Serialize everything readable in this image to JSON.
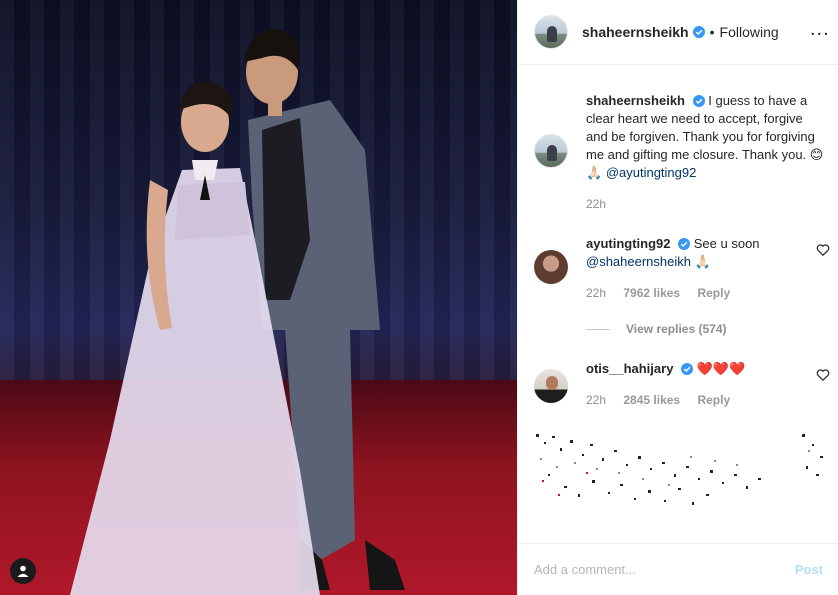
{
  "post": {
    "username": "shaheernsheikh",
    "separator": "•",
    "follow_status": "Following",
    "more_label": "...",
    "colors": {
      "verified": "#3897f0",
      "link": "#003569",
      "heart": "#c0152b",
      "muted": "#8e8e8e"
    }
  },
  "caption": {
    "username": "shaheernsheikh",
    "text": "I guess to have a clear heart we need to accept, forgive and be forgiven. Thank you for forgiving me and gifting me closure. Thank you. 😊🙏🏻",
    "mention": "@ayutingting92",
    "time": "22h"
  },
  "comments": [
    {
      "username": "ayutingting92",
      "text": "See u soon",
      "mention": "@shaheernsheikh",
      "emoji": "🙏🏻",
      "time": "22h",
      "likes": "7962 likes",
      "reply": "Reply"
    },
    {
      "username": "otis__hahijary",
      "text": "❤️❤️❤️",
      "time": "22h",
      "likes": "2845 likes",
      "reply": "Reply"
    }
  ],
  "view_replies": "View replies (574)",
  "footer": {
    "placeholder": "Add a comment...",
    "post": "Post"
  },
  "icons": [
    "verified-badge-icon",
    "more-options-icon",
    "heart-outline-icon",
    "user-tag-icon"
  ]
}
